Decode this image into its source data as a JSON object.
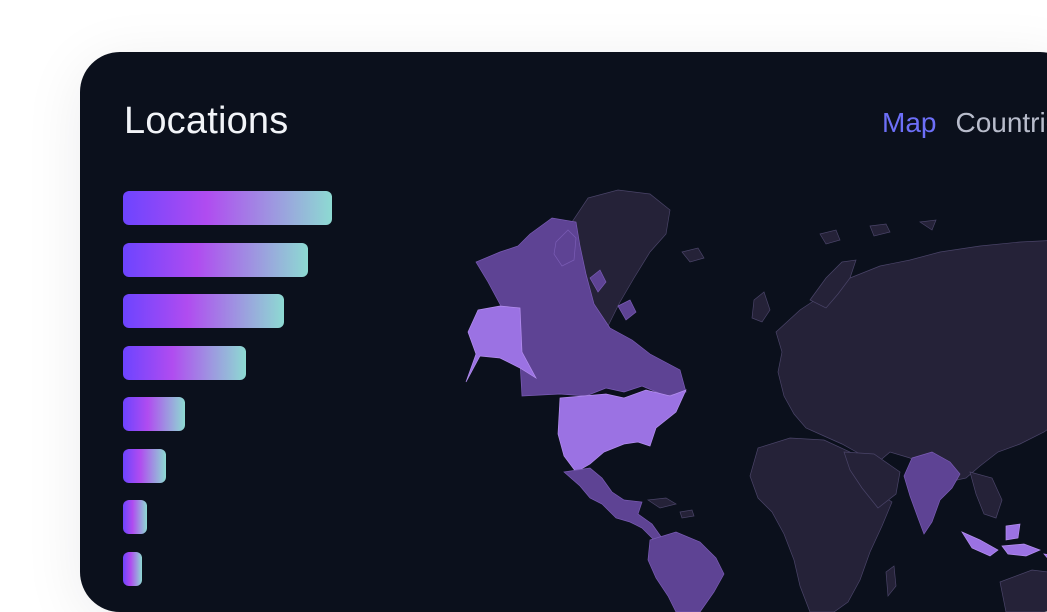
{
  "card": {
    "title": "Locations",
    "tabs": [
      {
        "label": "Map",
        "active": true
      },
      {
        "label": "Countries",
        "active": false
      }
    ]
  },
  "locations": {
    "bar_fractions": [
      1.0,
      0.885,
      0.77,
      0.59,
      0.296,
      0.206,
      0.115,
      0.09
    ],
    "gradient": [
      "#6d44ff",
      "#b04cf0",
      "#8ddad2"
    ]
  },
  "map": {
    "colors": {
      "background": "#0b101c",
      "land": "#252238",
      "medium": "#5e4394",
      "high": "#9b72e3"
    },
    "highlighted_regions": [
      "united-states",
      "alaska",
      "india",
      "indonesia"
    ],
    "medium_regions": [
      "canada",
      "greenland-dark",
      "mexico",
      "central-america",
      "south-america"
    ]
  }
}
